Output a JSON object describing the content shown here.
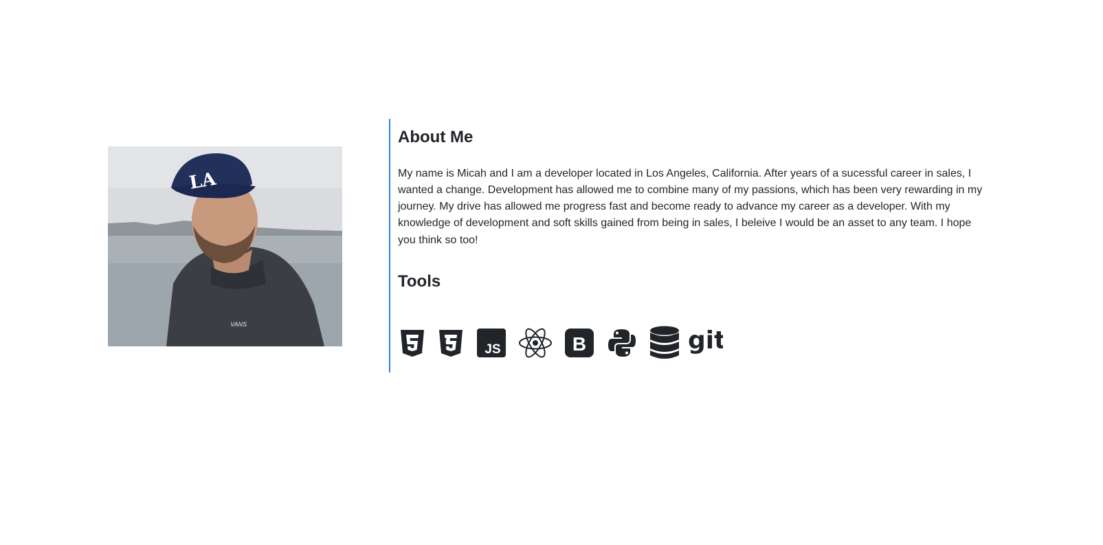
{
  "about": {
    "title": "About Me",
    "bio": "My name is Micah and I am a developer located in Los Angeles, California. After years of a sucessful career in sales, I wanted a change. Development has allowed me to combine many of my passions, which has been very rewarding in my journey. My drive has allowed me progress fast and become ready to advance my career as a developer. With my knowledge of development and soft skills gained from being in sales, I beleive I would be an asset to any team. I hope you think so too!"
  },
  "photo": {
    "cap_logo": "LA",
    "hoodie_logo": "VANS"
  },
  "tools": {
    "title": "Tools",
    "items": [
      {
        "icon": "html5-icon"
      },
      {
        "icon": "css3-icon"
      },
      {
        "icon": "javascript-icon",
        "text": "JS"
      },
      {
        "icon": "react-icon"
      },
      {
        "icon": "bootstrap-icon",
        "text": "B"
      },
      {
        "icon": "python-icon"
      },
      {
        "icon": "database-icon"
      },
      {
        "icon": "git-icon",
        "text": "git"
      }
    ]
  },
  "colors": {
    "accent": "#2b7de9",
    "text": "#212529",
    "icon": "#212529"
  }
}
